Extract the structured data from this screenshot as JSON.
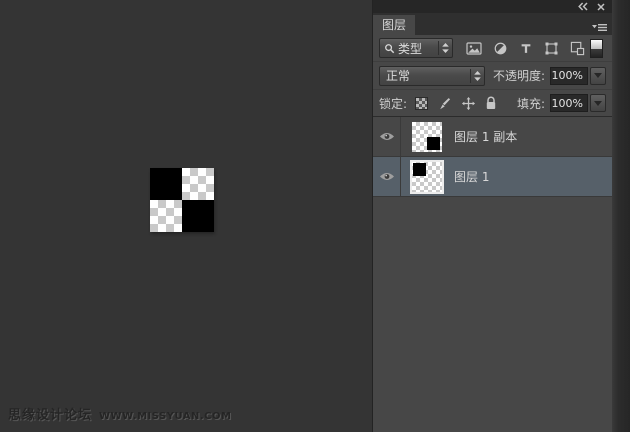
{
  "window": {
    "collapse_tooltip": "collapse-to-icons",
    "close_tooltip": "close"
  },
  "layers_panel": {
    "tab_label": "图层",
    "filter_bar": {
      "kind_label": "类型",
      "filter_icon_names": [
        "pixel-layer-filter",
        "adjustment-layer-filter",
        "type-layer-filter",
        "shape-layer-filter",
        "smart-object-filter"
      ],
      "toggle_name": "layer-filtering-toggle"
    },
    "blend_bar": {
      "blend_mode": "正常",
      "opacity_label": "不透明度:",
      "opacity_value": "100%"
    },
    "lock_bar": {
      "lock_label": "锁定:",
      "lock_icon_names": [
        "lock-transparent-pixels",
        "lock-image-pixels",
        "lock-position",
        "lock-all"
      ],
      "fill_label": "填充:",
      "fill_value": "100%"
    },
    "layers": [
      {
        "name": "图层 1 副本",
        "visible": true,
        "selected": false,
        "thumb_black_quadrant": "bottom-right"
      },
      {
        "name": "图层 1",
        "visible": true,
        "selected": true,
        "thumb_black_quadrant": "top-left"
      }
    ]
  },
  "canvas": {
    "artwork_note": "2x2 checker artwork: black top-left and bottom-right, transparent top-right and bottom-left",
    "watermark_text": "思缘设计论坛",
    "watermark_url": "WWW.MISSYUAN.COM"
  },
  "colors": {
    "canvas_bg": "#343434",
    "panel_bg": "#474747",
    "topbar_bg": "#262626",
    "selected_row": "#566069",
    "value_box_bg": "#292929"
  }
}
